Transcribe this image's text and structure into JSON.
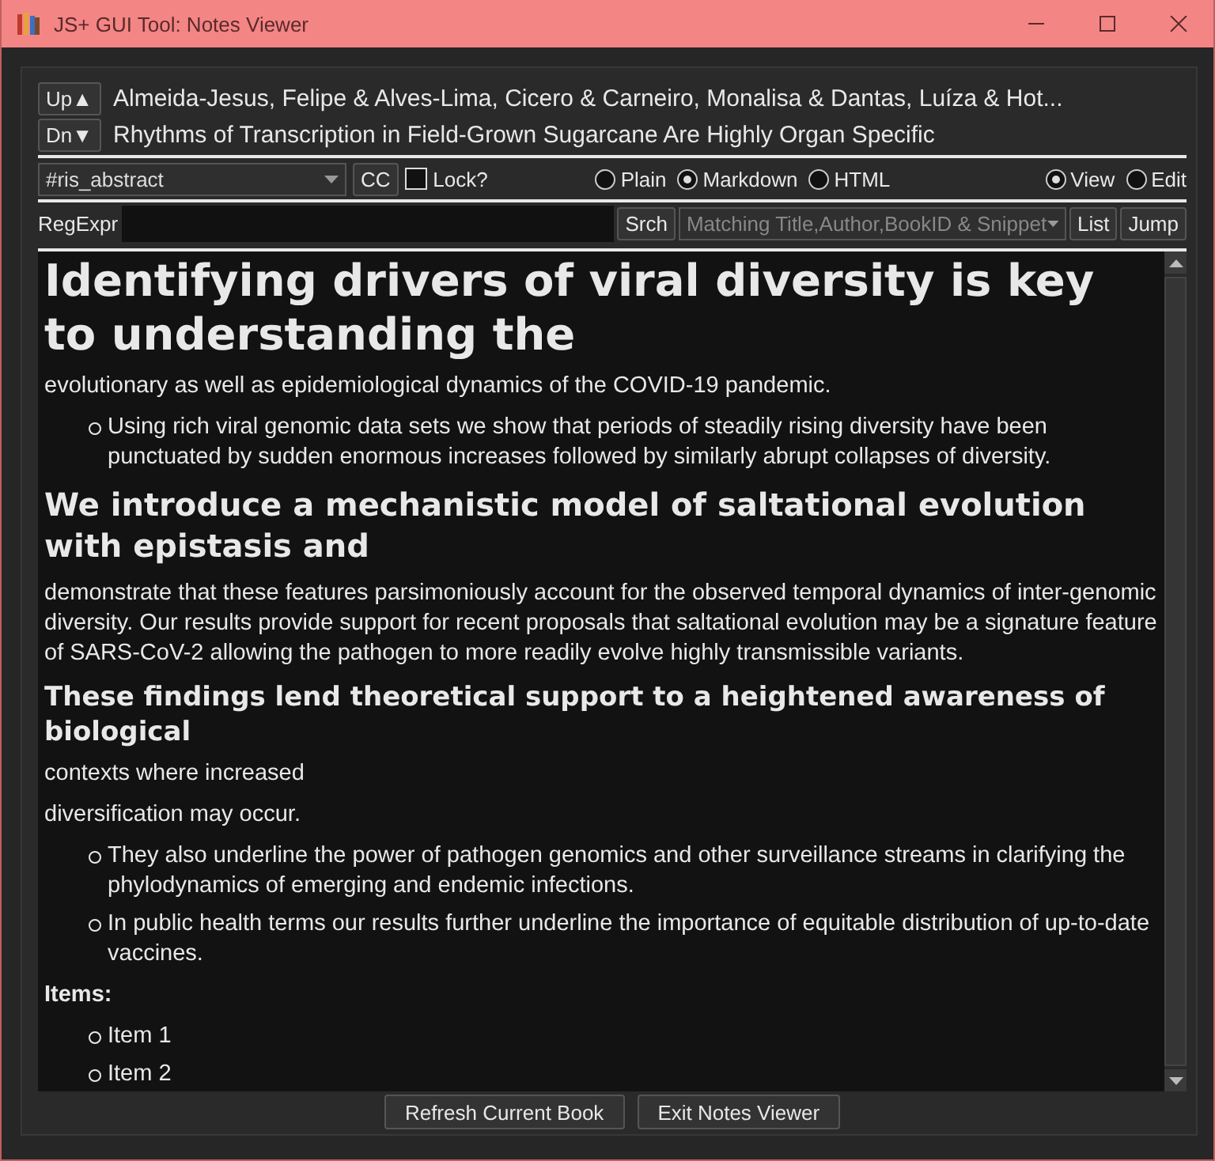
{
  "window": {
    "title": "JS+ GUI Tool:  Notes Viewer"
  },
  "nav": [
    {
      "label": "Up▲",
      "text": "Almeida-Jesus, Felipe & Alves-Lima, Cicero & Carneiro, Monalisa & Dantas, Luíza & Hot..."
    },
    {
      "label": "Dn▼",
      "text": "Rhythms of Transcription in Field-Grown Sugarcane Are Highly Organ Specific"
    }
  ],
  "toolbar": {
    "field": "#ris_abstract",
    "cc": "CC",
    "lock": {
      "label": "Lock?",
      "checked": false
    },
    "formats": [
      {
        "label": "Plain",
        "selected": false
      },
      {
        "label": "Markdown",
        "selected": true
      },
      {
        "label": "HTML",
        "selected": false
      }
    ],
    "modes": [
      {
        "label": "View",
        "selected": true
      },
      {
        "label": "Edit",
        "selected": false
      }
    ]
  },
  "search": {
    "label": "RegExpr",
    "button": "Srch",
    "match": "Matching Title,Author,BookID & Snippet",
    "buttons": [
      "List",
      "Jump"
    ]
  },
  "content": [
    {
      "kind": "h1",
      "text": "Identifying drivers of viral diversity is key to understanding the"
    },
    {
      "kind": "p",
      "text": "evolutionary as well as epidemiological dynamics of the COVID-19 pandemic."
    },
    {
      "kind": "list",
      "items": [
        "Using rich viral genomic data sets we show that periods of steadily rising diversity have been punctuated by sudden enormous increases followed by similarly abrupt collapses of diversity."
      ]
    },
    {
      "kind": "h2",
      "text": "We introduce a mechanistic model of saltational evolution with epistasis and"
    },
    {
      "kind": "p",
      "text": "demonstrate that these features parsimoniously account for the observed temporal dynamics of inter-genomic diversity. Our results provide support for recent proposals that saltational evolution may be a signature feature of SARS-CoV-2 allowing the pathogen to more readily evolve highly transmissible variants."
    },
    {
      "kind": "h3",
      "text": "These findings lend theoretical support to a heightened awareness of biological"
    },
    {
      "kind": "p",
      "text": "contexts where increased"
    },
    {
      "kind": "p",
      "text": "diversification may occur."
    },
    {
      "kind": "list",
      "items": [
        "They also underline the power of pathogen genomics and other surveillance streams in clarifying the phylodynamics of emerging and endemic infections.",
        "In public health terms our results further underline the importance of equitable distribution of up-to-date vaccines."
      ]
    },
    {
      "kind": "strong",
      "text": "Items:"
    },
    {
      "kind": "list",
      "items": [
        "Item 1",
        "Item 2"
      ]
    }
  ],
  "footer": [
    "Refresh Current Book",
    "Exit Notes Viewer"
  ]
}
